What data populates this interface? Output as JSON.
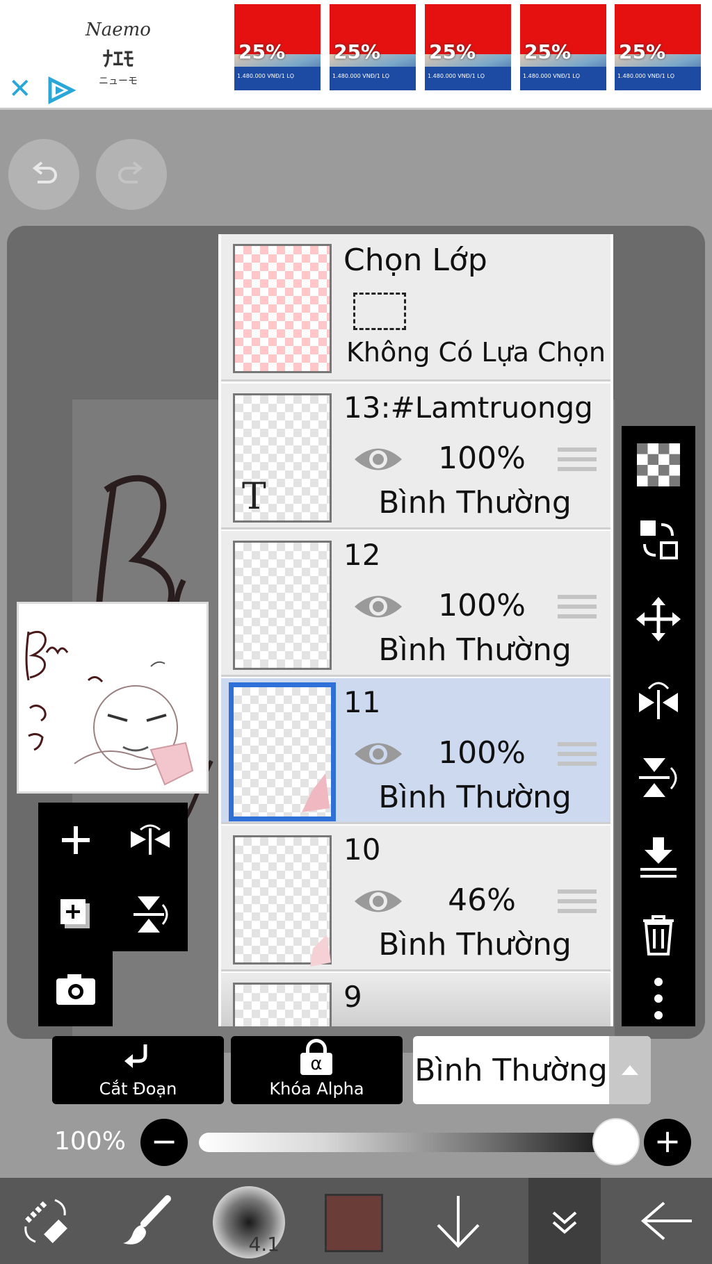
{
  "ad": {
    "logo_line1": "Naemo",
    "logo_line2": "ﾅｴﾓ",
    "logo_line3": "ニューモ",
    "tiles": [
      {
        "discount": "25%",
        "price": "1.480.000 VNĐ/1 LỌ"
      },
      {
        "discount": "25%",
        "price": "1.480.000 VNĐ/1 LỌ"
      },
      {
        "discount": "25%",
        "price": "1.480.000 VNĐ/1 LỌ"
      },
      {
        "discount": "25%",
        "price": "1.480.000 VNĐ/1 LỌ"
      },
      {
        "discount": "25%",
        "price": "1.480.000 VNĐ/1 LỌ"
      }
    ],
    "close_glyph": "✕"
  },
  "selection": {
    "title": "Chọn Lớp",
    "none_label": "Không Có Lựa Chọn"
  },
  "layers": [
    {
      "name": "13:#Lamtruongg",
      "opacity": "100%",
      "mode": "Bình Thường",
      "text_layer_glyph": "T"
    },
    {
      "name": "12",
      "opacity": "100%",
      "mode": "Bình Thường"
    },
    {
      "name": "11",
      "opacity": "100%",
      "mode": "Bình Thường"
    },
    {
      "name": "10",
      "opacity": "46%",
      "mode": "Bình Thường"
    },
    {
      "name": "9"
    }
  ],
  "layer_controls": {
    "clipping_label": "Cắt Đoạn",
    "alpha_lock_label": "Khóa Alpha",
    "alpha_glyph": "α",
    "blend_mode": "Bình Thường",
    "opacity_label": "100%",
    "opacity_value": 1.0
  },
  "brush": {
    "size_label": "4.1",
    "color": "#6b3d39"
  },
  "colors": {
    "selected_layer_bg": "#ccd9ef",
    "selected_border": "#2f6fd8",
    "ad_red": "#e51010"
  }
}
